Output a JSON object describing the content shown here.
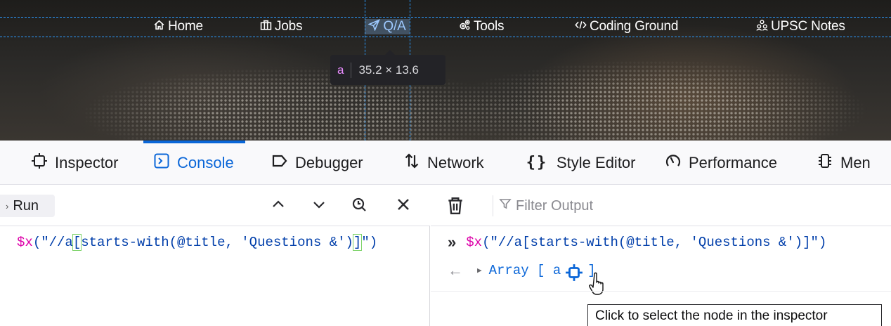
{
  "nav": {
    "items": [
      {
        "label": "Home",
        "icon": "home-icon"
      },
      {
        "label": "Jobs",
        "icon": "briefcase-icon"
      },
      {
        "label": "Q/A",
        "icon": "send-icon"
      },
      {
        "label": "Tools",
        "icon": "gears-icon"
      },
      {
        "label": "Coding Ground",
        "icon": "code-icon"
      },
      {
        "label": "UPSC Notes",
        "icon": "people-icon"
      }
    ],
    "highlight_color": "#2a9bff"
  },
  "element_tooltip": {
    "tag": "a",
    "dims": "35.2 × 13.6"
  },
  "devtools": {
    "tabs": [
      {
        "label": "Inspector",
        "icon": "inspector-icon"
      },
      {
        "label": "Console",
        "icon": "console-icon",
        "selected": true
      },
      {
        "label": "Debugger",
        "icon": "debugger-icon"
      },
      {
        "label": "Network",
        "icon": "network-arrows-icon"
      },
      {
        "label": "Style Editor",
        "icon": "braces-icon"
      },
      {
        "label": "Performance",
        "icon": "gauge-icon"
      },
      {
        "label": "Men",
        "icon": "memory-chip-icon"
      }
    ],
    "accent": "#0a66d8"
  },
  "editor": {
    "run_label": "Run",
    "code_prefix": "$x",
    "code_mid": "(\"//a",
    "code_open": "[",
    "code_body": "starts-with(@title, 'Questions &')",
    "code_close": "]",
    "code_end": "\")"
  },
  "output": {
    "filter_placeholder": "Filter Output",
    "input_fn": "$x",
    "input_args": "(\"//a[starts-with(@title, 'Questions &')]\")",
    "result_open": "Array [ a",
    "result_close": "]",
    "tooltip": "Click to select the node in the inspector"
  }
}
